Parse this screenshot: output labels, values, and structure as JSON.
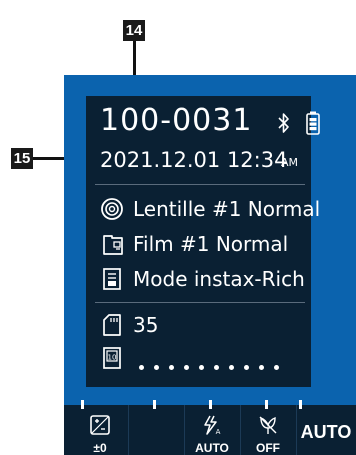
{
  "callouts": {
    "c14": "14",
    "c15": "15"
  },
  "status": {
    "counter": "100-0031",
    "date": "2021.12.01",
    "time": "12:34",
    "ampm": "AM",
    "icons": [
      "bluetooth-icon",
      "battery-icon"
    ]
  },
  "settings": {
    "lens": "Lentille #1 Normal",
    "film": "Film #1 Normal",
    "mode": "Mode instax-Rich"
  },
  "memory": {
    "shots_remaining": "35",
    "film_count_dots": 10
  },
  "bottom_bar": {
    "exposure_label": "±0",
    "flash_label": "AUTO",
    "macro_label": "OFF",
    "mode_label": "AUTO"
  },
  "colors": {
    "frame": "#0b63ae",
    "panel": "#0a2033",
    "text": "#ffffff"
  }
}
